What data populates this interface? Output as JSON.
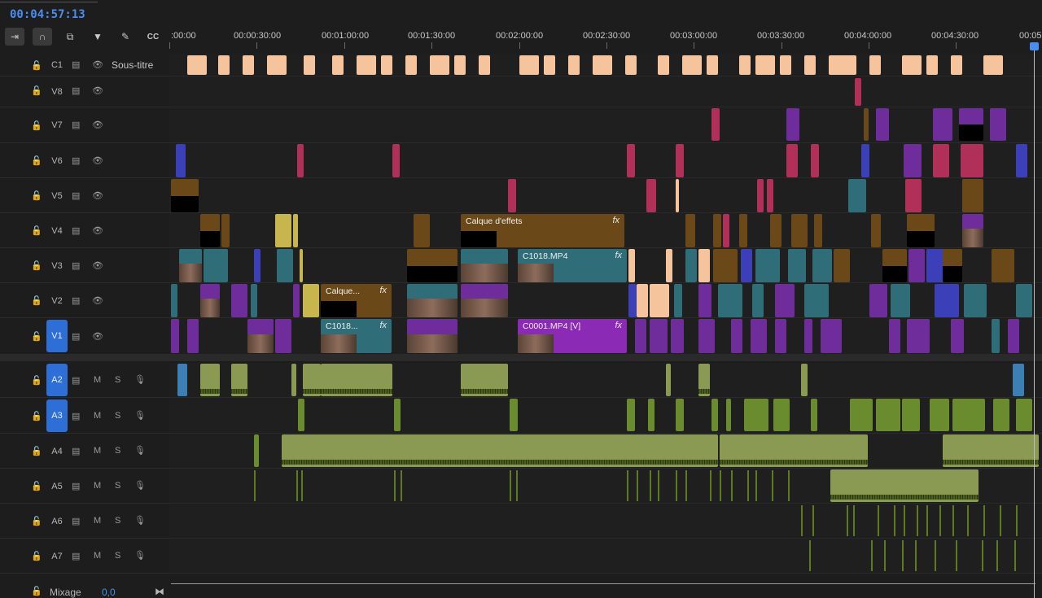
{
  "timecode": "00:04:57:13",
  "toolbar": [
    {
      "name": "insert-overwrite-icon",
      "glyph": "⇥",
      "on": true
    },
    {
      "name": "snap-icon",
      "glyph": "∩",
      "on": true
    },
    {
      "name": "linked-selection-icon",
      "glyph": "⧉",
      "on": false
    },
    {
      "name": "add-marker-icon",
      "glyph": "▼",
      "on": false
    },
    {
      "name": "settings-wrench-icon",
      "glyph": "✎",
      "on": false
    },
    {
      "name": "captions-icon",
      "glyph": "CC",
      "on": false
    }
  ],
  "ruler": {
    "labels": [
      ":00:00",
      "00:00:30:00",
      "00:01:00:00",
      "00:01:30:00",
      "00:02:00:00",
      "00:02:30:00",
      "00:03:00:00",
      "00:03:30:00",
      "00:04:00:00",
      "00:04:30:00",
      "00:05"
    ]
  },
  "tracks": {
    "caption": {
      "id": "C1",
      "label": "Sous-titre"
    },
    "video": [
      {
        "id": "V8"
      },
      {
        "id": "V7"
      },
      {
        "id": "V6"
      },
      {
        "id": "V5"
      },
      {
        "id": "V4"
      },
      {
        "id": "V3"
      },
      {
        "id": "V2"
      },
      {
        "id": "V1",
        "selected": true
      }
    ],
    "audio": [
      {
        "id": "A2",
        "selected": true,
        "m": "M",
        "s": "S"
      },
      {
        "id": "A3",
        "selected": true,
        "m": "M",
        "s": "S"
      },
      {
        "id": "A4",
        "m": "M",
        "s": "S"
      },
      {
        "id": "A5",
        "m": "M",
        "s": "S"
      },
      {
        "id": "A6",
        "m": "M",
        "s": "S"
      },
      {
        "id": "A7",
        "m": "M",
        "s": "S"
      }
    ]
  },
  "clips": {
    "v4_effects": {
      "label": "Calque d'effets",
      "fx": "fx"
    },
    "v3_c1018": {
      "label": "C1018.MP4",
      "fx": "fx"
    },
    "v2_calque": {
      "label": "Calque...",
      "fx": "fx"
    },
    "v1_c1018": {
      "label": "C1018...",
      "fx": "fx"
    },
    "v1_c0001": {
      "label": "C0001.MP4 [V]",
      "fx": "fx"
    }
  },
  "mix": {
    "label": "Mixage",
    "value": "0,0"
  },
  "colors": {
    "accent": "#2d6fd6",
    "timecode": "#4a8df0",
    "caption": "#f5c49c",
    "audio": "#8a9a52"
  }
}
